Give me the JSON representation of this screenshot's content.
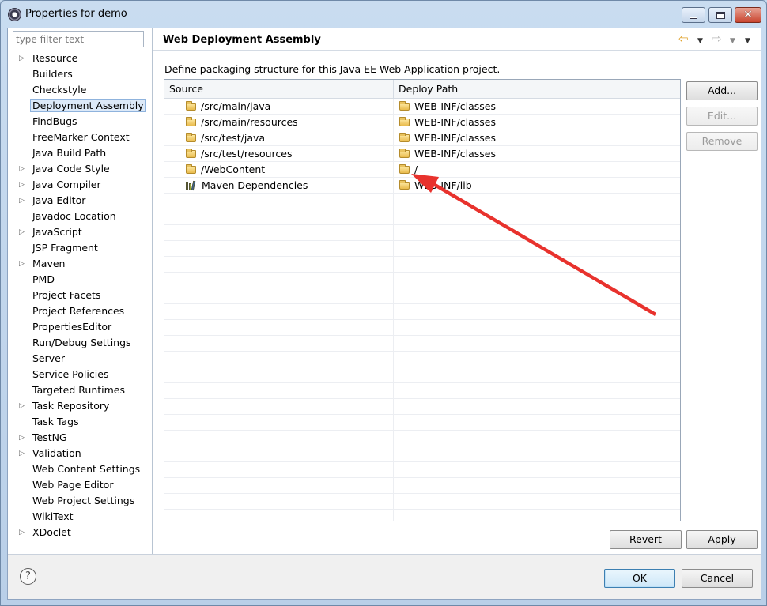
{
  "window": {
    "title": "Properties for demo"
  },
  "filter": {
    "placeholder": "type filter text"
  },
  "nav": {
    "items": [
      {
        "label": "Resource",
        "expandable": true
      },
      {
        "label": "Builders",
        "expandable": false
      },
      {
        "label": "Checkstyle",
        "expandable": false
      },
      {
        "label": "Deployment Assembly",
        "expandable": false,
        "selected": true
      },
      {
        "label": "FindBugs",
        "expandable": false
      },
      {
        "label": "FreeMarker Context",
        "expandable": false
      },
      {
        "label": "Java Build Path",
        "expandable": false
      },
      {
        "label": "Java Code Style",
        "expandable": true
      },
      {
        "label": "Java Compiler",
        "expandable": true
      },
      {
        "label": "Java Editor",
        "expandable": true
      },
      {
        "label": "Javadoc Location",
        "expandable": false
      },
      {
        "label": "JavaScript",
        "expandable": true
      },
      {
        "label": "JSP Fragment",
        "expandable": false
      },
      {
        "label": "Maven",
        "expandable": true
      },
      {
        "label": "PMD",
        "expandable": false
      },
      {
        "label": "Project Facets",
        "expandable": false
      },
      {
        "label": "Project References",
        "expandable": false
      },
      {
        "label": "PropertiesEditor",
        "expandable": false
      },
      {
        "label": "Run/Debug Settings",
        "expandable": false
      },
      {
        "label": "Server",
        "expandable": false
      },
      {
        "label": "Service Policies",
        "expandable": false
      },
      {
        "label": "Targeted Runtimes",
        "expandable": false
      },
      {
        "label": "Task Repository",
        "expandable": true
      },
      {
        "label": "Task Tags",
        "expandable": false
      },
      {
        "label": "TestNG",
        "expandable": true
      },
      {
        "label": "Validation",
        "expandable": true
      },
      {
        "label": "Web Content Settings",
        "expandable": false
      },
      {
        "label": "Web Page Editor",
        "expandable": false
      },
      {
        "label": "Web Project Settings",
        "expandable": false
      },
      {
        "label": "WikiText",
        "expandable": false
      },
      {
        "label": "XDoclet",
        "expandable": true
      }
    ]
  },
  "page": {
    "title": "Web Deployment Assembly",
    "description": "Define packaging structure for this Java EE Web Application project."
  },
  "table": {
    "columns": [
      "Source",
      "Deploy Path"
    ],
    "rows": [
      {
        "source": "/src/main/java",
        "deploy": "WEB-INF/classes",
        "icon": "folder-icon"
      },
      {
        "source": "/src/main/resources",
        "deploy": "WEB-INF/classes",
        "icon": "folder-icon"
      },
      {
        "source": "/src/test/java",
        "deploy": "WEB-INF/classes",
        "icon": "folder-icon"
      },
      {
        "source": "/src/test/resources",
        "deploy": "WEB-INF/classes",
        "icon": "folder-icon"
      },
      {
        "source": "/WebContent",
        "deploy": "/",
        "icon": "folder-icon"
      },
      {
        "source": "Maven Dependencies",
        "deploy": "WEB-INF/lib",
        "icon": "maven-library-icon"
      }
    ],
    "empty_rows": 21
  },
  "buttons": {
    "add": "Add...",
    "edit": "Edit...",
    "remove": "Remove",
    "revert": "Revert",
    "apply": "Apply",
    "ok": "OK",
    "cancel": "Cancel"
  },
  "help": {
    "icon": "help-icon",
    "glyph": "?"
  },
  "colors": {
    "annotation_arrow": "#e8322d",
    "selection": "#dce9f8"
  }
}
